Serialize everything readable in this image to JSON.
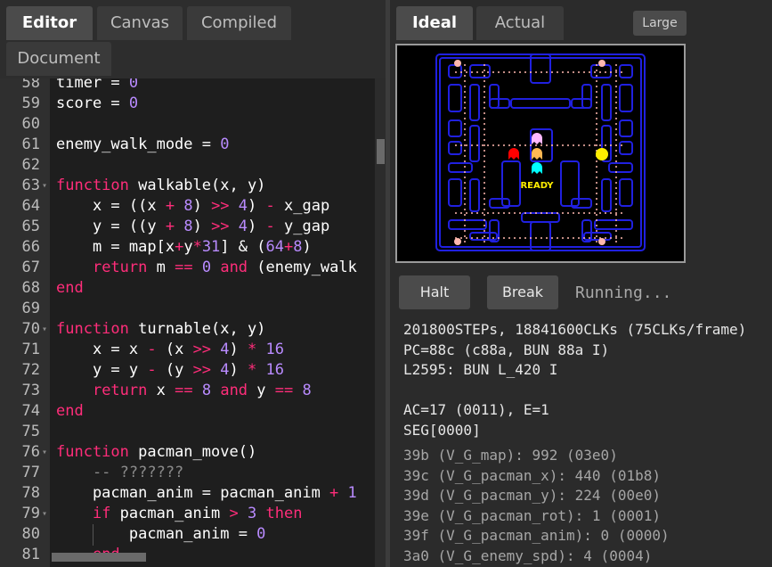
{
  "left_tabs": [
    "Editor",
    "Canvas",
    "Compiled",
    "Document"
  ],
  "right_tabs": [
    "Ideal",
    "Actual"
  ],
  "size_button": "Large",
  "buttons": {
    "halt": "Halt",
    "break": "Break"
  },
  "status": "Running...",
  "screen": {
    "ready_text": "READY"
  },
  "code_lines": [
    {
      "n": "58",
      "fold": "",
      "tokens": [
        [
          "timer = ",
          ""
        ],
        [
          "0",
          "num"
        ]
      ]
    },
    {
      "n": "59",
      "fold": "",
      "tokens": [
        [
          "score = ",
          ""
        ],
        [
          "0",
          "num"
        ]
      ]
    },
    {
      "n": "60",
      "fold": "",
      "tokens": []
    },
    {
      "n": "61",
      "fold": "",
      "tokens": [
        [
          "enemy_walk_mode = ",
          ""
        ],
        [
          "0",
          "num"
        ]
      ]
    },
    {
      "n": "62",
      "fold": "",
      "tokens": []
    },
    {
      "n": "63",
      "fold": "▾",
      "tokens": [
        [
          "function",
          "kw"
        ],
        [
          " walkable(x, y)",
          ""
        ]
      ]
    },
    {
      "n": "64",
      "fold": "",
      "tokens": [
        [
          "    x = ((x ",
          ""
        ],
        [
          "+",
          "op"
        ],
        [
          " ",
          ""
        ],
        [
          "8",
          "num"
        ],
        [
          ") ",
          ""
        ],
        [
          ">>",
          "op"
        ],
        [
          " ",
          ""
        ],
        [
          "4",
          "num"
        ],
        [
          ") ",
          ""
        ],
        [
          "-",
          "op"
        ],
        [
          " x_gap",
          ""
        ]
      ]
    },
    {
      "n": "65",
      "fold": "",
      "tokens": [
        [
          "    y = ((y ",
          ""
        ],
        [
          "+",
          "op"
        ],
        [
          " ",
          ""
        ],
        [
          "8",
          "num"
        ],
        [
          ") ",
          ""
        ],
        [
          ">>",
          "op"
        ],
        [
          " ",
          ""
        ],
        [
          "4",
          "num"
        ],
        [
          ") ",
          ""
        ],
        [
          "-",
          "op"
        ],
        [
          " y_gap",
          ""
        ]
      ]
    },
    {
      "n": "66",
      "fold": "",
      "tokens": [
        [
          "    m = map[x",
          ""
        ],
        [
          "+",
          "op"
        ],
        [
          "y",
          ""
        ],
        [
          "*",
          "op"
        ],
        [
          "31",
          "num"
        ],
        [
          "] & (",
          ""
        ],
        [
          "64",
          "num"
        ],
        [
          "+",
          "op"
        ],
        [
          "8",
          "num"
        ],
        [
          ")",
          ""
        ]
      ]
    },
    {
      "n": "67",
      "fold": "",
      "tokens": [
        [
          "    ",
          ""
        ],
        [
          "return",
          "kw"
        ],
        [
          " m ",
          ""
        ],
        [
          "==",
          "op"
        ],
        [
          " ",
          ""
        ],
        [
          "0",
          "num"
        ],
        [
          " ",
          ""
        ],
        [
          "and",
          "kw"
        ],
        [
          " (enemy_walk",
          ""
        ]
      ]
    },
    {
      "n": "68",
      "fold": "",
      "tokens": [
        [
          "end",
          "kw"
        ]
      ]
    },
    {
      "n": "69",
      "fold": "",
      "tokens": []
    },
    {
      "n": "70",
      "fold": "▾",
      "tokens": [
        [
          "function",
          "kw"
        ],
        [
          " turnable(x, y)",
          ""
        ]
      ]
    },
    {
      "n": "71",
      "fold": "",
      "tokens": [
        [
          "    x = x ",
          ""
        ],
        [
          "-",
          "op"
        ],
        [
          " (x ",
          ""
        ],
        [
          ">>",
          "op"
        ],
        [
          " ",
          ""
        ],
        [
          "4",
          "num"
        ],
        [
          ") ",
          ""
        ],
        [
          "*",
          "op"
        ],
        [
          " ",
          ""
        ],
        [
          "16",
          "num"
        ]
      ]
    },
    {
      "n": "72",
      "fold": "",
      "tokens": [
        [
          "    y = y ",
          ""
        ],
        [
          "-",
          "op"
        ],
        [
          " (y ",
          ""
        ],
        [
          ">>",
          "op"
        ],
        [
          " ",
          ""
        ],
        [
          "4",
          "num"
        ],
        [
          ") ",
          ""
        ],
        [
          "*",
          "op"
        ],
        [
          " ",
          ""
        ],
        [
          "16",
          "num"
        ]
      ]
    },
    {
      "n": "73",
      "fold": "",
      "tokens": [
        [
          "    ",
          ""
        ],
        [
          "return",
          "kw"
        ],
        [
          " x ",
          ""
        ],
        [
          "==",
          "op"
        ],
        [
          " ",
          ""
        ],
        [
          "8",
          "num"
        ],
        [
          " ",
          ""
        ],
        [
          "and",
          "kw"
        ],
        [
          " y ",
          ""
        ],
        [
          "==",
          "op"
        ],
        [
          " ",
          ""
        ],
        [
          "8",
          "num"
        ]
      ]
    },
    {
      "n": "74",
      "fold": "",
      "tokens": [
        [
          "end",
          "kw"
        ]
      ]
    },
    {
      "n": "75",
      "fold": "",
      "tokens": []
    },
    {
      "n": "76",
      "fold": "▾",
      "tokens": [
        [
          "function",
          "kw"
        ],
        [
          " pacman_move()",
          ""
        ]
      ]
    },
    {
      "n": "77",
      "fold": "",
      "tokens": [
        [
          "    -- ???????",
          "cm"
        ]
      ]
    },
    {
      "n": "78",
      "fold": "",
      "tokens": [
        [
          "    pacman_anim = pacman_anim ",
          ""
        ],
        [
          "+",
          "op"
        ],
        [
          " ",
          ""
        ],
        [
          "1",
          "num"
        ]
      ]
    },
    {
      "n": "79",
      "fold": "▾",
      "tokens": [
        [
          "    ",
          ""
        ],
        [
          "if",
          "kw"
        ],
        [
          " pacman_anim ",
          ""
        ],
        [
          ">",
          "op"
        ],
        [
          " ",
          ""
        ],
        [
          "3",
          "num"
        ],
        [
          " ",
          ""
        ],
        [
          "then",
          "kw"
        ]
      ]
    },
    {
      "n": "80",
      "fold": "",
      "tokens": [
        [
          "        pacman_anim = ",
          ""
        ],
        [
          "0",
          "num"
        ]
      ]
    },
    {
      "n": "81",
      "fold": "",
      "tokens": [
        [
          "    ",
          ""
        ],
        [
          "end",
          "kw"
        ]
      ]
    }
  ],
  "cpu_info": [
    "201800STEPs, 18841600CLKs (75CLKs/frame)",
    "PC=88c (c88a, BUN 88a I)",
    "L2595: BUN L_420 I",
    "",
    "AC=17 (0011), E=1",
    "SEG[0000]"
  ],
  "memory": [
    "39b (V_G_map): 992 (03e0)",
    "39c (V_G_pacman_x): 440 (01b8)",
    "39d (V_G_pacman_y): 224 (00e0)",
    "39e (V_G_pacman_rot): 1 (0001)",
    "39f (V_G_pacman_anim): 0 (0000)",
    "3a0 (V_G_enemy_spd): 4 (0004)"
  ],
  "colors": {
    "keyword": "#ff2d7a",
    "number": "#b98bff",
    "maze_wall": "#2020e0",
    "pacman": "#ffee00"
  }
}
